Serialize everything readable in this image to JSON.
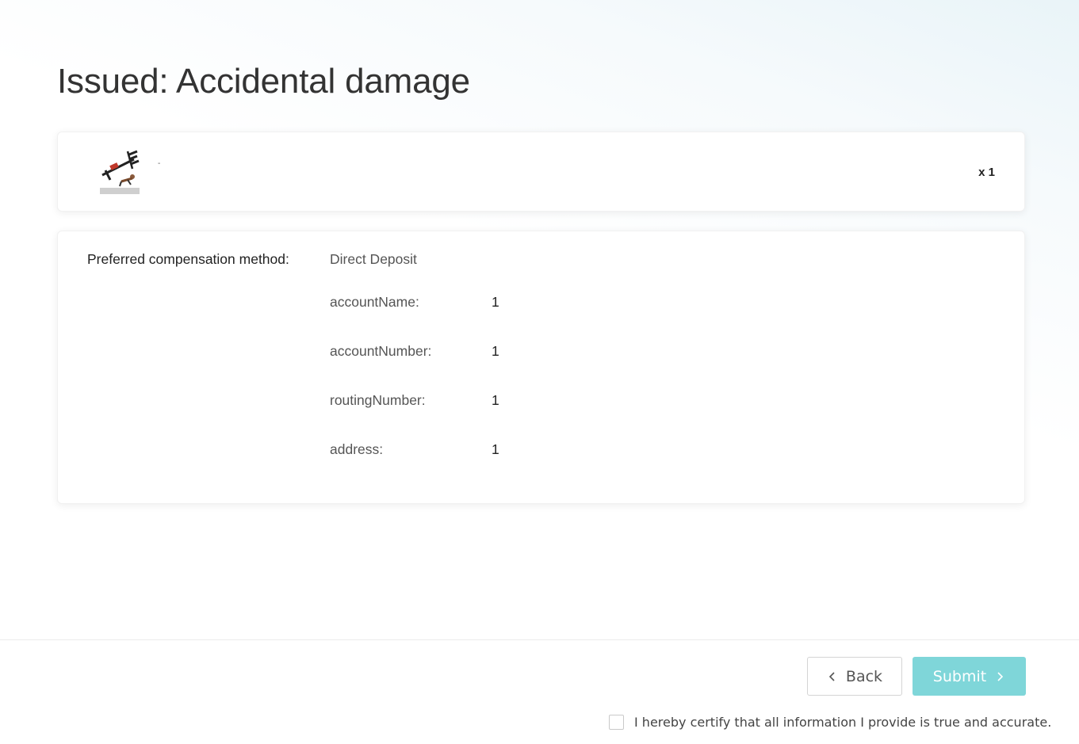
{
  "page": {
    "title": "Issued: Accidental damage"
  },
  "product": {
    "icon": "workout-bench-thumbnail",
    "name": "-",
    "quantity": "x 1"
  },
  "compensation": {
    "label": "Preferred compensation method:",
    "method": "Direct Deposit",
    "fields": [
      {
        "key": "accountName:",
        "value": "1"
      },
      {
        "key": "accountNumber:",
        "value": "1"
      },
      {
        "key": "routingNumber:",
        "value": "1"
      },
      {
        "key": "address:",
        "value": "1"
      }
    ]
  },
  "footer": {
    "back_label": "Back",
    "submit_label": "Submit",
    "certify_text": "I hereby certify that all information I provide is true and accurate.",
    "certify_checked": false,
    "accent_color": "#7fd6d9"
  }
}
